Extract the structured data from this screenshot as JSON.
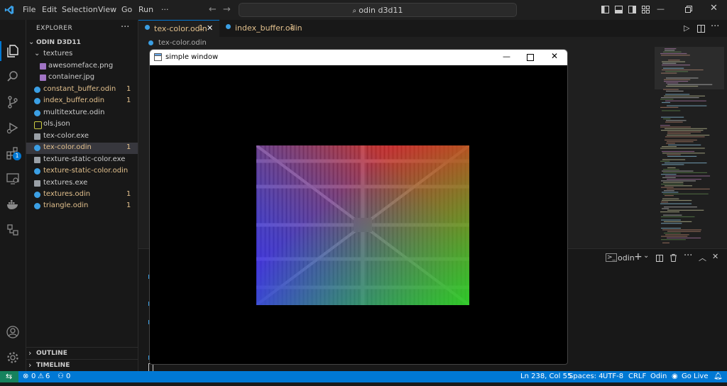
{
  "menubar": {
    "items": [
      "File",
      "Edit",
      "Selection",
      "View",
      "Go",
      "Run",
      "···"
    ],
    "search_text": "odin d3d11"
  },
  "sidebar": {
    "title": "EXPLORER",
    "more": "···",
    "folder": "ODIN D3D11",
    "subfolder": "textures",
    "files": [
      {
        "name": "awesomeface.png",
        "count": "",
        "indent": 2,
        "modified": false,
        "icon": "image"
      },
      {
        "name": "container.jpg",
        "count": "",
        "indent": 2,
        "modified": false,
        "icon": "image"
      },
      {
        "name": "constant_buffer.odin",
        "count": "1",
        "indent": 1,
        "modified": true,
        "icon": "odin"
      },
      {
        "name": "index_buffer.odin",
        "count": "1",
        "indent": 1,
        "modified": true,
        "icon": "odin"
      },
      {
        "name": "multitexture.odin",
        "count": "",
        "indent": 1,
        "modified": false,
        "icon": "odin"
      },
      {
        "name": "ols.json",
        "count": "",
        "indent": 1,
        "modified": false,
        "icon": "json"
      },
      {
        "name": "tex-color.exe",
        "count": "",
        "indent": 1,
        "modified": false,
        "icon": "exe"
      },
      {
        "name": "tex-color.odin",
        "count": "1",
        "indent": 1,
        "modified": true,
        "icon": "odin",
        "selected": true
      },
      {
        "name": "texture-static-color.exe",
        "count": "",
        "indent": 1,
        "modified": false,
        "icon": "exe"
      },
      {
        "name": "texture-static-color.odin",
        "count": "",
        "indent": 1,
        "modified": true,
        "icon": "odin"
      },
      {
        "name": "textures.exe",
        "count": "",
        "indent": 1,
        "modified": false,
        "icon": "exe"
      },
      {
        "name": "textures.odin",
        "count": "1",
        "indent": 1,
        "modified": true,
        "icon": "odin"
      },
      {
        "name": "triangle.odin",
        "count": "1",
        "indent": 1,
        "modified": true,
        "icon": "odin"
      }
    ],
    "outline": "OUTLINE",
    "timeline": "TIMELINE"
  },
  "tabs": [
    {
      "label": "tex-color.odin",
      "count": "1",
      "active": true
    },
    {
      "label": "index_buffer.odin",
      "count": "1",
      "active": false
    }
  ],
  "breadcrumb": "tex-color.odin",
  "panel": {
    "terminal_name": "odin"
  },
  "simple_window": {
    "title": "simple window"
  },
  "status": {
    "errors": "0",
    "warnings": "6",
    "ports": "0",
    "position": "Ln 238, Col 55",
    "spaces": "Spaces: 4",
    "encoding": "UTF-8",
    "eol": "CRLF",
    "language": "Odin",
    "golive": "Go Live"
  },
  "colors": {
    "accent": "#0078d4",
    "modified": "#e2c08d",
    "remote": "#16825d"
  }
}
